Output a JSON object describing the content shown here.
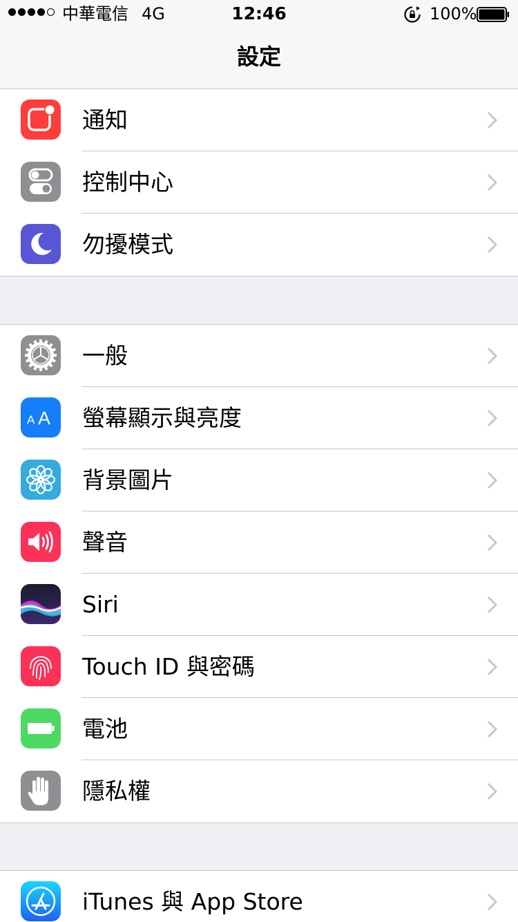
{
  "status_bar": {
    "carrier": "中華電信",
    "network": "4G",
    "time": "12:46",
    "battery": "100%"
  },
  "nav": {
    "title": "設定"
  },
  "groups": [
    {
      "items": [
        {
          "label": "通知",
          "icon": "notifications-icon",
          "color": "#fc3d39"
        },
        {
          "label": "控制中心",
          "icon": "control-center-icon",
          "color": "#8e8e93"
        },
        {
          "label": "勿擾模式",
          "icon": "moon-icon",
          "color": "#5856d6"
        }
      ]
    },
    {
      "items": [
        {
          "label": "一般",
          "icon": "gear-icon",
          "color": "#8e8e93"
        },
        {
          "label": "螢幕顯示與亮度",
          "icon": "display-brightness-icon",
          "color": "#147efb"
        },
        {
          "label": "背景圖片",
          "icon": "wallpaper-flower-icon",
          "color": "#35aadc"
        },
        {
          "label": "聲音",
          "icon": "speaker-icon",
          "color": "#fc3158"
        },
        {
          "label": "Siri",
          "icon": "siri-icon",
          "color": "#1c1c3a"
        },
        {
          "label": "Touch ID 與密碼",
          "icon": "fingerprint-icon",
          "color": "#fc3158"
        },
        {
          "label": "電池",
          "icon": "battery-icon",
          "color": "#4cd964"
        },
        {
          "label": "隱私權",
          "icon": "hand-icon",
          "color": "#8e8e93"
        }
      ]
    },
    {
      "items": [
        {
          "label": "iTunes 與 App Store",
          "icon": "app-store-icon",
          "color": "#1a8bfb"
        }
      ]
    }
  ]
}
